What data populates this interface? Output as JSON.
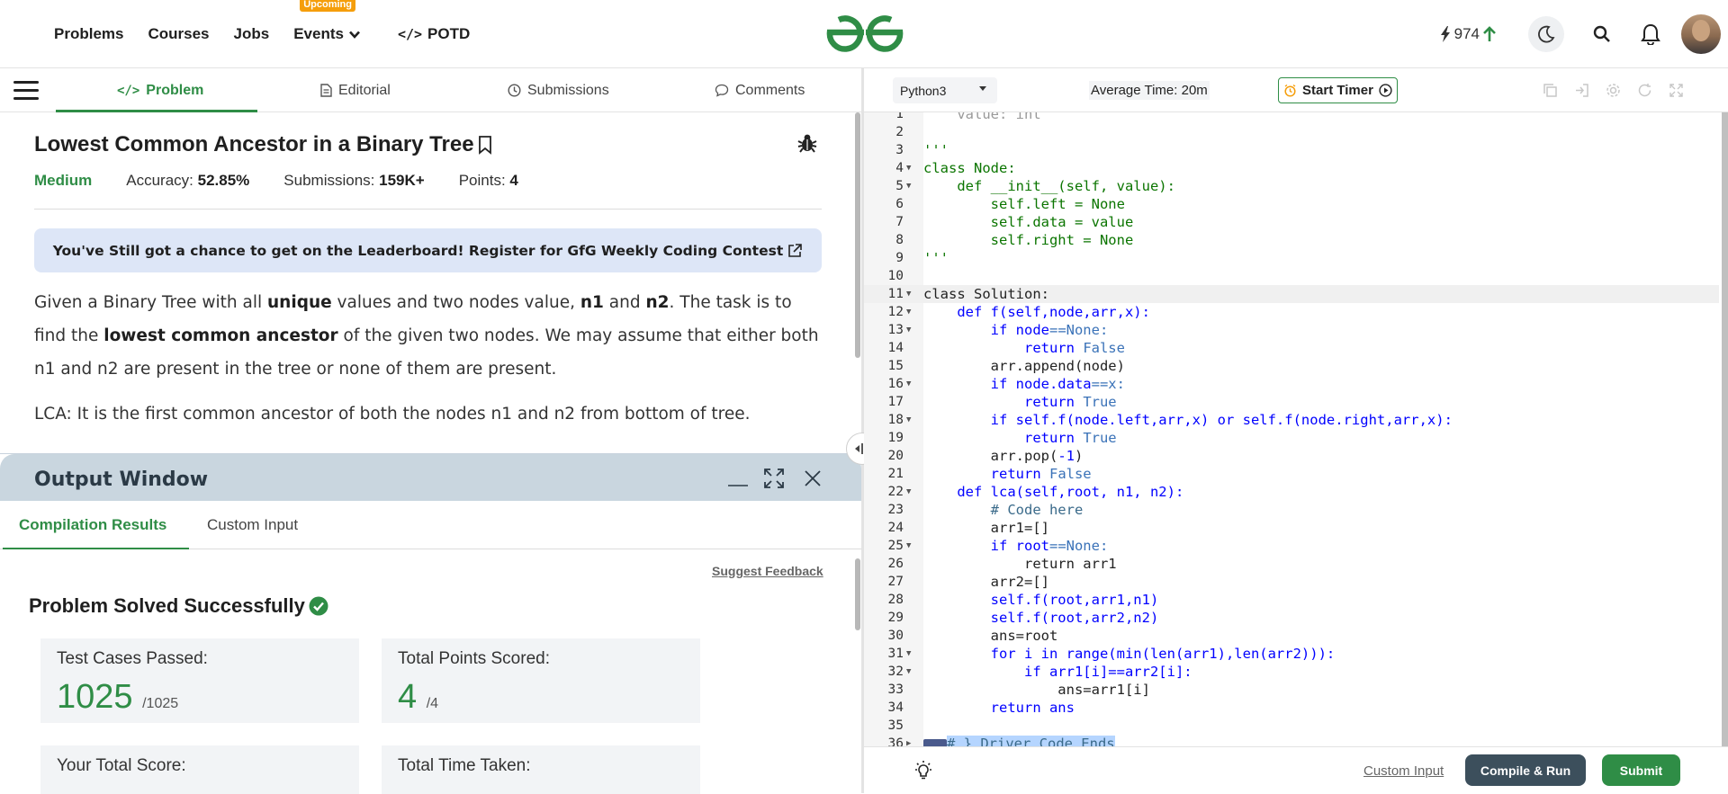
{
  "nav": {
    "links": [
      "Problems",
      "Courses",
      "Jobs",
      "Events",
      "POTD"
    ],
    "events_badge": "Upcoming",
    "potd_prefix": "</>",
    "streak": "974"
  },
  "tabs": {
    "problem": "Problem",
    "editorial": "Editorial",
    "submissions": "Submissions",
    "comments": "Comments"
  },
  "problem": {
    "title": "Lowest Common Ancestor in a Binary Tree",
    "difficulty": "Medium",
    "accuracy_label": "Accuracy:",
    "accuracy": "52.85%",
    "submissions_label": "Submissions:",
    "submissions": "159K+",
    "points_label": "Points:",
    "points": "4",
    "banner": "You've Still got a chance to get on the Leaderboard! Register for GfG Weekly Coding Contest",
    "desc": {
      "t1": "Given a Binary Tree with all ",
      "b1": "unique",
      "t2": " values and two nodes value, ",
      "b2": "n1",
      "t3": " and ",
      "b3": "n2",
      "t4": ". The task is to find the ",
      "b4": "lowest common ancestor",
      "t5": " of the given two nodes. We may assume that either both n1 and n2 are present in the tree or none of them are present."
    },
    "lca": "LCA: It is the first common ancestor of both the nodes n1 and n2 from bottom of tree."
  },
  "output": {
    "title": "Output Window",
    "tab_results": "Compilation Results",
    "tab_custom": "Custom Input",
    "feedback": "Suggest Feedback",
    "solved": "Problem Solved Successfully",
    "cards": {
      "tests_label": "Test Cases Passed:",
      "tests_value": "1025",
      "tests_total": "/1025",
      "points_label": "Total Points Scored:",
      "points_value": "4",
      "points_total": "/4",
      "score_label": "Your Total Score:",
      "time_label": "Total Time Taken:"
    }
  },
  "editor": {
    "language": "Python3",
    "avg_time": "Average Time: 20m",
    "timer": "Start Timer",
    "lines": {
      "l2": "",
      "l3": "'''",
      "l4": "class Node:",
      "l5a": "    def __init__(self, value):",
      "l6": "        self.left = None",
      "l7": "        self.data = value",
      "l8": "        self.right = None",
      "l9": "'''",
      "l11": "class Solution:",
      "l12": "    def f(self,node,arr,x):",
      "l13a": "        if node",
      "l13b": "==None:",
      "l14a": "            return ",
      "l14b": "False",
      "l15": "        arr.append(node)",
      "l16a": "        if node.data",
      "l16b": "==x:",
      "l17a": "            return ",
      "l17b": "True",
      "l18": "        if self.f(node.left,arr,x) or self.f(node.right,arr,x):",
      "l19a": "            return ",
      "l19b": "True",
      "l20a": "        arr.pop(",
      "l20b": "-1",
      "l20c": ")",
      "l21a": "        return ",
      "l21b": "False",
      "l22": "    def lca(self,root, n1, n2):",
      "l23": "        # Code here",
      "l24": "        arr1=[]",
      "l25a": "        if root",
      "l25b": "==None:",
      "l26": "            return arr1",
      "l27": "        arr2=[]",
      "l28": "        self.f(root,arr1,n1)",
      "l29": "        self.f(root,arr2,n2)",
      "l30": "        ans=root",
      "l31": "        for i in range(min(len(arr1),len(arr2))):",
      "l32": "            if arr1[i]==arr2[i]:",
      "l33": "                ans=arr1[i]",
      "l34": "        return ans",
      "l36": "# } Driver Code Ends"
    },
    "custom_input": "Custom Input",
    "run": "Compile & Run",
    "submit": "Submit"
  }
}
